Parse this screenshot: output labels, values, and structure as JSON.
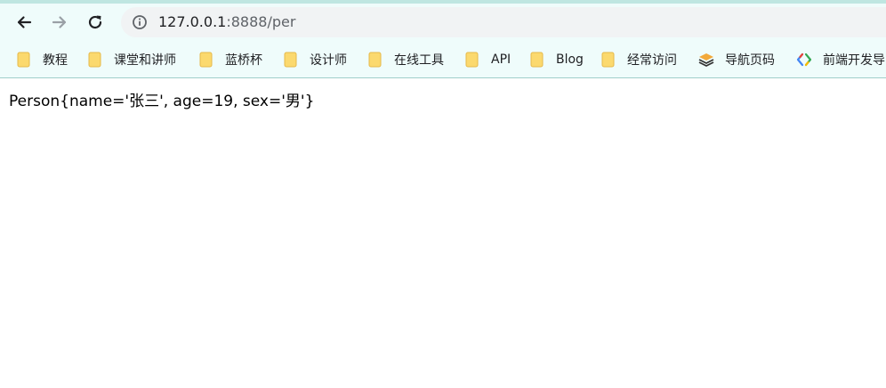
{
  "toolbar": {
    "back_icon": "arrow-left-icon",
    "forward_icon": "arrow-right-icon",
    "reload_icon": "reload-icon",
    "info_icon": "info-circle-icon",
    "url_host": "127.0.0.1",
    "url_rest": ":8888/per"
  },
  "bookmarks": [
    {
      "label": "教程",
      "icon": "folder-icon"
    },
    {
      "label": "课堂和讲师",
      "icon": "folder-icon"
    },
    {
      "label": "蓝桥杯",
      "icon": "folder-icon"
    },
    {
      "label": "设计师",
      "icon": "folder-icon"
    },
    {
      "label": "在线工具",
      "icon": "folder-icon"
    },
    {
      "label": "API",
      "icon": "folder-icon"
    },
    {
      "label": "Blog",
      "icon": "folder-icon"
    },
    {
      "label": "经常访问",
      "icon": "folder-icon"
    },
    {
      "label": "导航页码",
      "icon": "layers-icon"
    },
    {
      "label": "前端开发导",
      "icon": "code-icon"
    }
  ],
  "page": {
    "output_text": "Person{name='张三', age=19, sex='男'}"
  },
  "colors": {
    "toolbar_bg": "#effcfb",
    "top_strip": "#bfe6e1",
    "folder": "#fbd96e"
  }
}
